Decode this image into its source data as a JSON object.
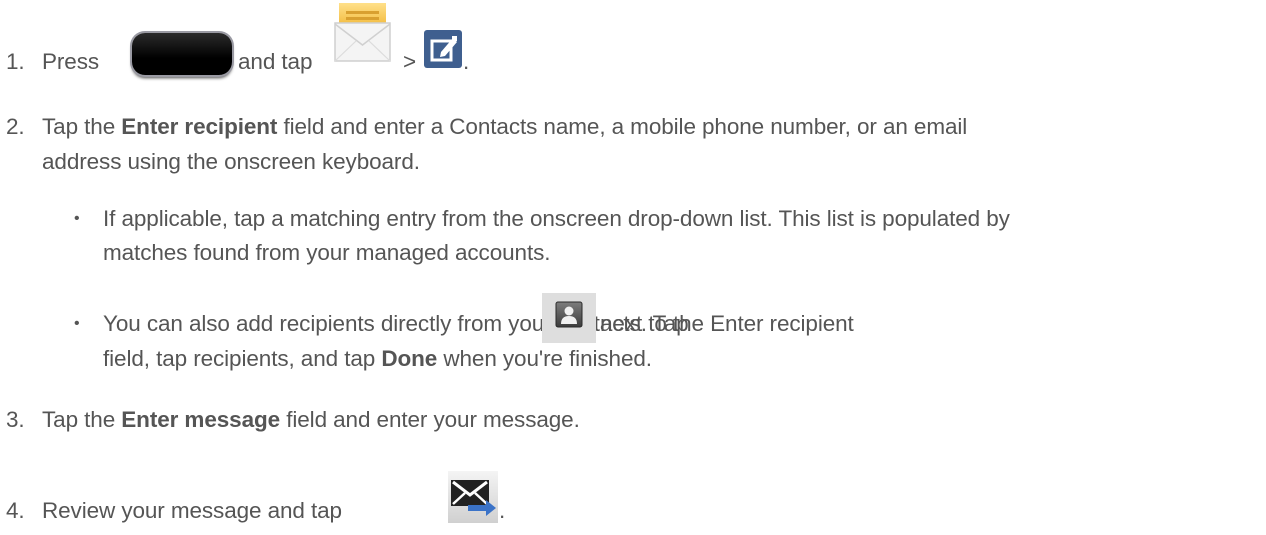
{
  "steps": [
    {
      "number": "1.",
      "press": "Press",
      "and_tap": "and tap",
      "gt": ">",
      "period": ".",
      "icons": [
        "home-key-icon",
        "messaging-envelope-icon",
        "compose-icon"
      ]
    },
    {
      "number": "2.",
      "pre": "Tap the",
      "bold": "Enter recipient",
      "post": "field and enter a Contacts name, a mobile phone number, or an email",
      "line2": "address using the onscreen keyboard.",
      "bullets": [
        {
          "line1": "If applicable, tap a matching entry from the onscreen drop-down list. This list is populated by",
          "line2": "matches found from your managed accounts."
        },
        {
          "pre": "You can also add recipients directly from your contacts. Tap",
          "icon": "contact-picker-icon",
          "post": "next to the Enter recipient",
          "line2_pre": "field, tap recipients, and tap",
          "line2_bold": "Done",
          "line2_post": "when you're finished."
        }
      ]
    },
    {
      "number": "3.",
      "pre": "Tap the",
      "bold": "Enter message",
      "post": "field and enter your message."
    },
    {
      "number": "4.",
      "text": "Review your message and tap",
      "icon": "send-icon",
      "period": "."
    }
  ],
  "bullet_glyph": "•"
}
